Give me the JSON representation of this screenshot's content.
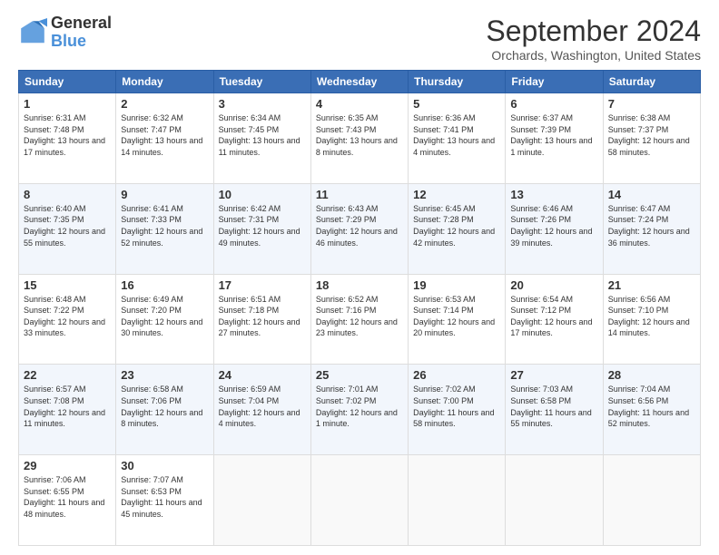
{
  "logo": {
    "line1": "General",
    "line2": "Blue"
  },
  "header": {
    "month": "September 2024",
    "location": "Orchards, Washington, United States"
  },
  "weekdays": [
    "Sunday",
    "Monday",
    "Tuesday",
    "Wednesday",
    "Thursday",
    "Friday",
    "Saturday"
  ],
  "rows": [
    [
      {
        "day": "1",
        "sunrise": "6:31 AM",
        "sunset": "7:48 PM",
        "daylight": "13 hours and 17 minutes."
      },
      {
        "day": "2",
        "sunrise": "6:32 AM",
        "sunset": "7:47 PM",
        "daylight": "13 hours and 14 minutes."
      },
      {
        "day": "3",
        "sunrise": "6:34 AM",
        "sunset": "7:45 PM",
        "daylight": "13 hours and 11 minutes."
      },
      {
        "day": "4",
        "sunrise": "6:35 AM",
        "sunset": "7:43 PM",
        "daylight": "13 hours and 8 minutes."
      },
      {
        "day": "5",
        "sunrise": "6:36 AM",
        "sunset": "7:41 PM",
        "daylight": "13 hours and 4 minutes."
      },
      {
        "day": "6",
        "sunrise": "6:37 AM",
        "sunset": "7:39 PM",
        "daylight": "13 hours and 1 minute."
      },
      {
        "day": "7",
        "sunrise": "6:38 AM",
        "sunset": "7:37 PM",
        "daylight": "12 hours and 58 minutes."
      }
    ],
    [
      {
        "day": "8",
        "sunrise": "6:40 AM",
        "sunset": "7:35 PM",
        "daylight": "12 hours and 55 minutes."
      },
      {
        "day": "9",
        "sunrise": "6:41 AM",
        "sunset": "7:33 PM",
        "daylight": "12 hours and 52 minutes."
      },
      {
        "day": "10",
        "sunrise": "6:42 AM",
        "sunset": "7:31 PM",
        "daylight": "12 hours and 49 minutes."
      },
      {
        "day": "11",
        "sunrise": "6:43 AM",
        "sunset": "7:29 PM",
        "daylight": "12 hours and 46 minutes."
      },
      {
        "day": "12",
        "sunrise": "6:45 AM",
        "sunset": "7:28 PM",
        "daylight": "12 hours and 42 minutes."
      },
      {
        "day": "13",
        "sunrise": "6:46 AM",
        "sunset": "7:26 PM",
        "daylight": "12 hours and 39 minutes."
      },
      {
        "day": "14",
        "sunrise": "6:47 AM",
        "sunset": "7:24 PM",
        "daylight": "12 hours and 36 minutes."
      }
    ],
    [
      {
        "day": "15",
        "sunrise": "6:48 AM",
        "sunset": "7:22 PM",
        "daylight": "12 hours and 33 minutes."
      },
      {
        "day": "16",
        "sunrise": "6:49 AM",
        "sunset": "7:20 PM",
        "daylight": "12 hours and 30 minutes."
      },
      {
        "day": "17",
        "sunrise": "6:51 AM",
        "sunset": "7:18 PM",
        "daylight": "12 hours and 27 minutes."
      },
      {
        "day": "18",
        "sunrise": "6:52 AM",
        "sunset": "7:16 PM",
        "daylight": "12 hours and 23 minutes."
      },
      {
        "day": "19",
        "sunrise": "6:53 AM",
        "sunset": "7:14 PM",
        "daylight": "12 hours and 20 minutes."
      },
      {
        "day": "20",
        "sunrise": "6:54 AM",
        "sunset": "7:12 PM",
        "daylight": "12 hours and 17 minutes."
      },
      {
        "day": "21",
        "sunrise": "6:56 AM",
        "sunset": "7:10 PM",
        "daylight": "12 hours and 14 minutes."
      }
    ],
    [
      {
        "day": "22",
        "sunrise": "6:57 AM",
        "sunset": "7:08 PM",
        "daylight": "12 hours and 11 minutes."
      },
      {
        "day": "23",
        "sunrise": "6:58 AM",
        "sunset": "7:06 PM",
        "daylight": "12 hours and 8 minutes."
      },
      {
        "day": "24",
        "sunrise": "6:59 AM",
        "sunset": "7:04 PM",
        "daylight": "12 hours and 4 minutes."
      },
      {
        "day": "25",
        "sunrise": "7:01 AM",
        "sunset": "7:02 PM",
        "daylight": "12 hours and 1 minute."
      },
      {
        "day": "26",
        "sunrise": "7:02 AM",
        "sunset": "7:00 PM",
        "daylight": "11 hours and 58 minutes."
      },
      {
        "day": "27",
        "sunrise": "7:03 AM",
        "sunset": "6:58 PM",
        "daylight": "11 hours and 55 minutes."
      },
      {
        "day": "28",
        "sunrise": "7:04 AM",
        "sunset": "6:56 PM",
        "daylight": "11 hours and 52 minutes."
      }
    ],
    [
      {
        "day": "29",
        "sunrise": "7:06 AM",
        "sunset": "6:55 PM",
        "daylight": "11 hours and 48 minutes."
      },
      {
        "day": "30",
        "sunrise": "7:07 AM",
        "sunset": "6:53 PM",
        "daylight": "11 hours and 45 minutes."
      },
      null,
      null,
      null,
      null,
      null
    ]
  ]
}
